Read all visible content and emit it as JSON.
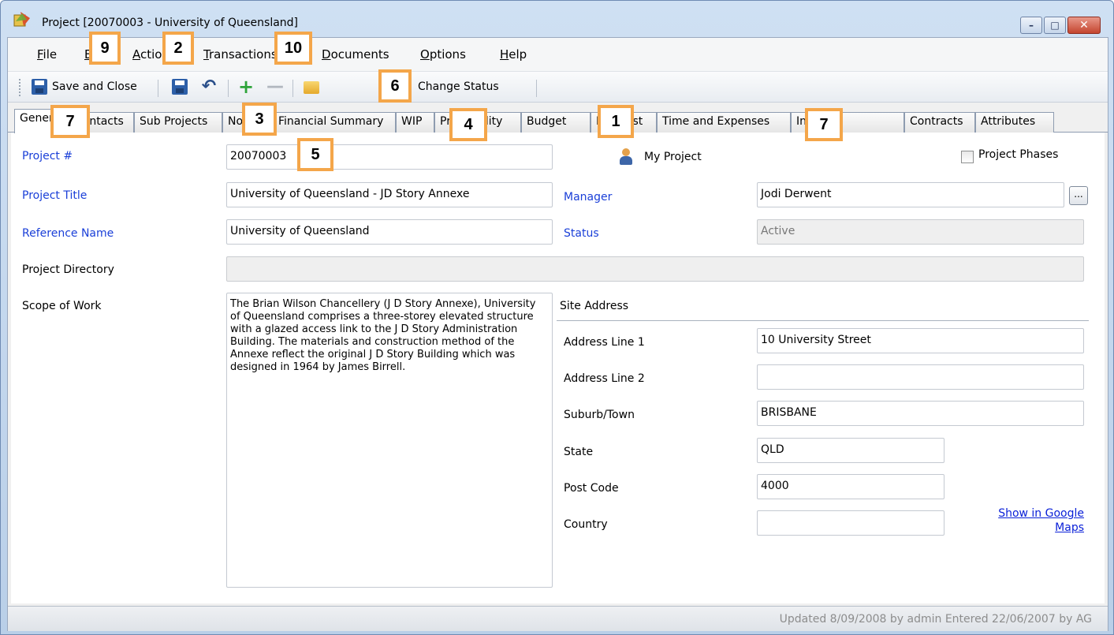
{
  "window": {
    "title": "Project [20070003 - University of Queensland]",
    "minimize_glyph": "–",
    "maximize_glyph": "□",
    "close_glyph": "✕"
  },
  "menu": {
    "items": [
      {
        "label": "File",
        "key": "F",
        "rest": "ile"
      },
      {
        "label": "Edit",
        "key": "E",
        "rest": "dit"
      },
      {
        "label": "Actions",
        "key": "A",
        "rest": "ctions"
      },
      {
        "label": "Transactions",
        "key": "T",
        "rest": "ransactions"
      },
      {
        "label": "Documents",
        "key": "D",
        "rest": "ocuments"
      },
      {
        "label": "Options",
        "key": "O",
        "rest": "ptions"
      },
      {
        "label": "Help",
        "key": "H",
        "rest": "elp"
      }
    ]
  },
  "toolbar": {
    "save_close_label": "Save and Close",
    "change_status_label": "Change Status",
    "undo_glyph": "↶",
    "add_glyph": "+",
    "remove_glyph": "—"
  },
  "tabs": [
    "General",
    "Contacts",
    "Sub Projects",
    "Notes",
    "Financial Summary",
    "WIP",
    "Profitability",
    "Budget",
    "Forecast",
    "Time and Expenses",
    "Invoices",
    "Contracts",
    "Attributes"
  ],
  "form": {
    "project_number_label": "Project #",
    "project_number": "20070003",
    "my_project_label": "My Project",
    "project_phases_label": "Project Phases",
    "project_title_label": "Project Title",
    "project_title": "University of Queensland - JD Story Annexe",
    "manager_label": "Manager",
    "manager": "Jodi Derwent",
    "manager_button": "...",
    "reference_name_label": "Reference Name",
    "reference_name": "University of Queensland",
    "status_label": "Status",
    "status": "Active",
    "project_directory_label": "Project Directory",
    "project_directory": "",
    "scope_label": "Scope of Work",
    "scope": "The Brian Wilson Chancellery (J D Story Annexe), University of Queensland comprises a three-storey elevated structure with a glazed access link to the J D Story Administration Building. The materials and construction method of the Annexe reflect the original J D Story Building which was designed in 1964 by James Birrell."
  },
  "site_address": {
    "heading": "Site Address",
    "address1_label": "Address Line 1",
    "address1": "10 University Street",
    "address2_label": "Address Line 2",
    "address2": "",
    "suburb_label": "Suburb/Town",
    "suburb": "BRISBANE",
    "state_label": "State",
    "state": "QLD",
    "postcode_label": "Post Code",
    "postcode": "4000",
    "country_label": "Country",
    "country": "",
    "maps_link": "Show in Google Maps"
  },
  "statusbar": {
    "text": "Updated 8/09/2008 by admin  Entered 22/06/2007 by AG"
  },
  "callouts": [
    "9",
    "2",
    "10",
    "6",
    "7",
    "3",
    "4",
    "1",
    "7",
    "5"
  ],
  "colors": {
    "accent": "#f4a64a",
    "label_blue": "#1a3fd8",
    "link": "#0b21d8"
  }
}
